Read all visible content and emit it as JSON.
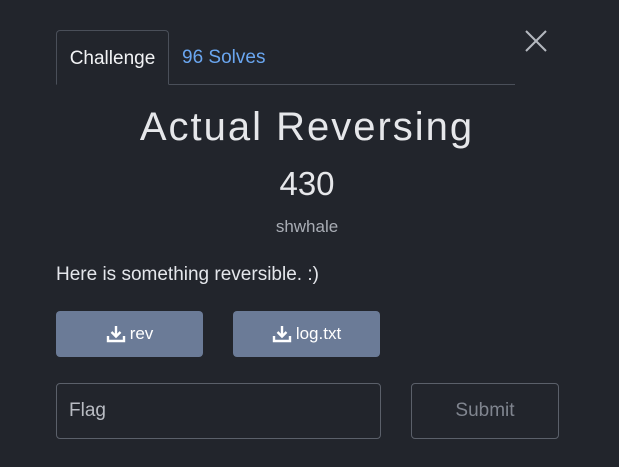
{
  "tabs": {
    "challenge_label": "Challenge",
    "solves_label": "96 Solves"
  },
  "challenge": {
    "name": "Actual Reversing",
    "points": "430",
    "author": "shwhale",
    "description": "Here is something reversible. :)"
  },
  "files": [
    {
      "label": "rev",
      "icon": "download-icon"
    },
    {
      "label": "log.txt",
      "icon": "download-icon"
    }
  ],
  "form": {
    "flag_placeholder": "Flag",
    "flag_value": "",
    "submit_label": "Submit"
  },
  "colors": {
    "background": "#22252c",
    "accent_link": "#6aa6f0",
    "file_button": "#6b7b97"
  }
}
